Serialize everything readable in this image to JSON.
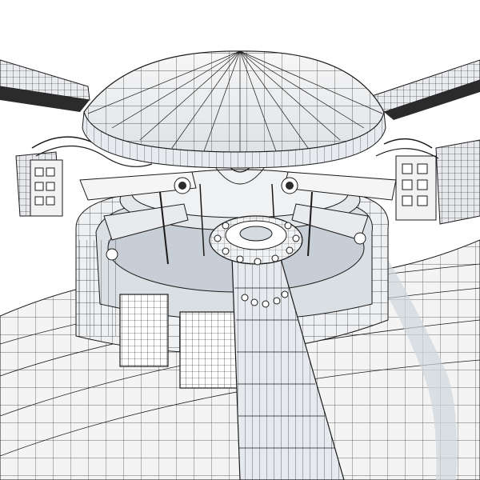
{
  "render": {
    "subject": "rotor-hub-wireframe",
    "palette": {
      "background": "#ffffff",
      "wire": "#1a1a1a",
      "wire_light": "#3a3a3a",
      "surface": "#f2f2f2",
      "shade": "#d9dde2",
      "shadow": "#b9c0c8",
      "dark": "#2b2b2b"
    }
  }
}
